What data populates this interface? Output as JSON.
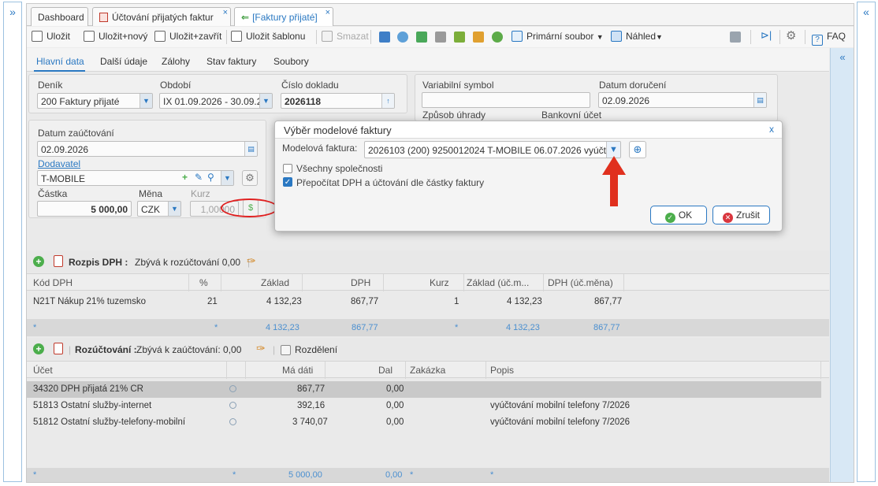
{
  "window_tabs": [
    {
      "label": "Dashboard"
    },
    {
      "label": "Účtování přijatých faktur"
    },
    {
      "label": "[Faktury přijaté]"
    }
  ],
  "toolbar": {
    "save": "Uložit",
    "save_new": "Uložit+nový",
    "save_close": "Uložit+zavřít",
    "save_template": "Uložit šablonu",
    "delete": "Smazat",
    "primary_file": "Primární soubor",
    "preview": "Náhled",
    "faq": "FAQ"
  },
  "form_tabs": [
    "Hlavní data",
    "Další údaje",
    "Zálohy",
    "Stav faktury",
    "Soubory"
  ],
  "header": {
    "journal_label": "Deník",
    "journal_value": "200 Faktury přijaté",
    "period_label": "Období",
    "period_value": "IX 01.09.2026 - 30.09.2",
    "doc_number_label": "Číslo dokladu",
    "doc_number_value": "2026118",
    "var_symbol_label": "Variabilní symbol",
    "var_symbol_value": "",
    "delivery_date_label": "Datum doručení",
    "delivery_date_value": "02.09.2026",
    "payment_method_label": "Způsob úhrady",
    "bank_account_label": "Bankovní účet"
  },
  "posting": {
    "date_label": "Datum zaúčtování",
    "date_value": "02.09.2026",
    "supplier_label": "Dodavatel",
    "supplier_value": "T-MOBILE",
    "amount_label": "Částka",
    "amount_value": "5 000,00",
    "currency_label": "Měna",
    "currency_value": "CZK",
    "rate_label": "Kurz",
    "rate_value": "1,00000"
  },
  "vat": {
    "title": "Rozpis DPH :",
    "remaining": "Zbývá k rozúčtování 0,00",
    "columns": [
      "Kód DPH",
      "%",
      "Základ",
      "DPH",
      "Kurz",
      "Základ (úč.m...",
      "DPH (úč.měna)"
    ],
    "rows": [
      {
        "code": "N21T Nákup 21% tuzemsko",
        "pct": "21",
        "base": "4 132,23",
        "vat": "867,77",
        "rate": "1",
        "base_acc": "4 132,23",
        "vat_acc": "867,77"
      }
    ],
    "footer": {
      "marker": "*",
      "pct": "*",
      "base": "4 132,23",
      "vat": "867,77",
      "rate": "*",
      "base_acc": "4 132,23",
      "vat_acc": "867,77"
    }
  },
  "allocation": {
    "title": "Rozúčtování :",
    "remaining": "Zbývá k zaúčtování: 0,00",
    "split": "Rozdělení",
    "columns": [
      "Účet",
      "Má dáti",
      "Dal",
      "Zakázka",
      "Popis"
    ],
    "rows": [
      {
        "account": "34320 DPH přijatá 21% CR",
        "debit": "867,77",
        "credit": "0,00",
        "order": "",
        "desc": ""
      },
      {
        "account": "51813 Ostatní služby-internet",
        "debit": "392,16",
        "credit": "0,00",
        "order": "",
        "desc": "vyúčtování mobilní telefony 7/2026"
      },
      {
        "account": "51812 Ostatní služby-telefony-mobilní",
        "debit": "3 740,07",
        "credit": "0,00",
        "order": "",
        "desc": "vyúčtování mobilní telefony 7/2026"
      }
    ],
    "footer": {
      "marker": "*",
      "mid": "*",
      "debit": "5 000,00",
      "credit": "0,00",
      "order": "*",
      "desc": "*"
    }
  },
  "dialog": {
    "title": "Výběr modelové faktury",
    "close": "x",
    "model_label": "Modelová faktura:",
    "model_value": "2026103 (200)  9250012024 T-MOBILE 06.07.2026  vyúčto",
    "all_companies": "Všechny společnosti",
    "recalc": "Přepočítat DPH a účtování dle částky faktury",
    "all_companies_checked": false,
    "recalc_checked": true,
    "ok": "OK",
    "cancel": "Zrušit"
  },
  "colors": {
    "accent": "#2a78c2",
    "highlight": "#e02020",
    "arrow": "#e0301e"
  }
}
